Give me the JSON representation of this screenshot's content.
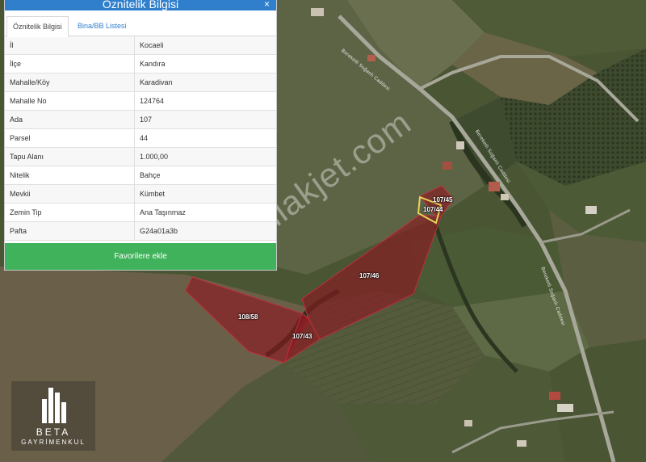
{
  "panel": {
    "title": "Öznitelik Bilgisi",
    "close_symbol": "×",
    "tabs": [
      {
        "label": "Öznitelik Bilgisi",
        "active": true
      },
      {
        "label": "Bina/BB Listesi",
        "active": false
      }
    ],
    "rows": [
      {
        "label": "İl",
        "value": "Kocaeli"
      },
      {
        "label": "İlçe",
        "value": "Kandıra"
      },
      {
        "label": "Mahalle/Köy",
        "value": "Karadivan"
      },
      {
        "label": "Mahalle No",
        "value": "124764"
      },
      {
        "label": "Ada",
        "value": "107"
      },
      {
        "label": "Parsel",
        "value": "44"
      },
      {
        "label": "Tapu Alanı",
        "value": "1.000,00"
      },
      {
        "label": "Nitelik",
        "value": "Bahçe"
      },
      {
        "label": "Mevkii",
        "value": "Kümbet"
      },
      {
        "label": "Zemin Tip",
        "value": "Ana Taşınmaz"
      },
      {
        "label": "Pafta",
        "value": "G24a01a3b"
      }
    ],
    "favorite_button": "Favorilere ekle"
  },
  "map": {
    "parcels": [
      {
        "id": "107/45",
        "highlighted": false
      },
      {
        "id": "107/44",
        "highlighted": true
      },
      {
        "id": "107/46",
        "highlighted": false
      },
      {
        "id": "108/58",
        "highlighted": false
      },
      {
        "id": "107/43",
        "highlighted": false
      }
    ],
    "road_labels": [
      "Bereketli Soğanlı Caddesi",
      "Bereketli Soğanlı Caddesi",
      "Bereketli Soğanlı Caddesi"
    ],
    "parcel_fill_color": "#8b1a22",
    "highlight_color": "#e8d25a"
  },
  "watermark": "emlakjet.com",
  "logo": {
    "name": "BETA",
    "subtitle": "GAYRİMENKUL"
  },
  "colors": {
    "header_blue": "#2f7fcc",
    "button_green": "#40b25b"
  }
}
